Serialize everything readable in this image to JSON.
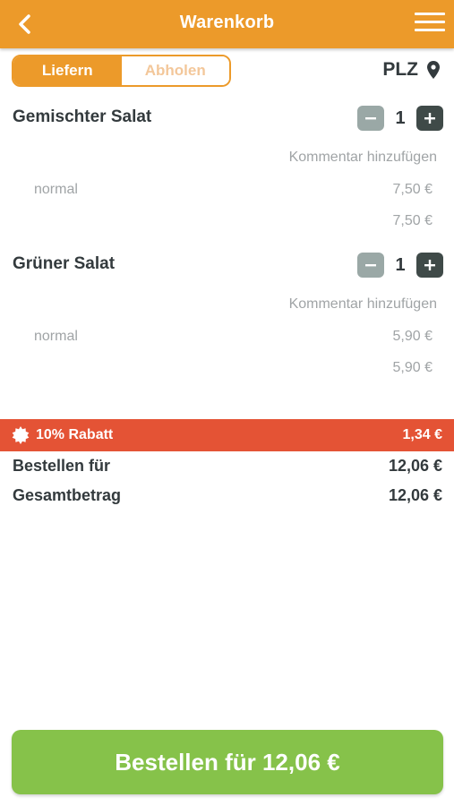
{
  "header": {
    "title": "Warenkorb",
    "back_icon": "chevron-left-icon",
    "menu_icon": "hamburger-menu-icon"
  },
  "delivery_toggle": {
    "options": [
      {
        "label": "Liefern",
        "active": true
      },
      {
        "label": "Abholen",
        "active": false
      }
    ]
  },
  "location": {
    "label": "PLZ",
    "icon": "map-pin-icon"
  },
  "items": [
    {
      "name": "Gemischter Salat",
      "quantity": "1",
      "comment_label": "Kommentar hinzufügen",
      "variant": "normal",
      "variant_price": "7,50 €",
      "line_total": "7,50 €"
    },
    {
      "name": "Grüner Salat",
      "quantity": "1",
      "comment_label": "Kommentar hinzufügen",
      "variant": "normal",
      "variant_price": "5,90 €",
      "line_total": "5,90 €"
    }
  ],
  "discount": {
    "label": "10% Rabatt",
    "amount": "1,34 €",
    "icon": "discount-badge-icon"
  },
  "summary": {
    "order_for_label": "Bestellen für",
    "order_for_value": "12,06 €",
    "total_label": "Gesamtbetrag",
    "total_value": "12,06 €"
  },
  "order_button": {
    "label": "Bestellen für 12,06 €"
  },
  "colors": {
    "brand": "#ec9a2a",
    "discount": "#e45335",
    "order_button": "#86c24a"
  }
}
